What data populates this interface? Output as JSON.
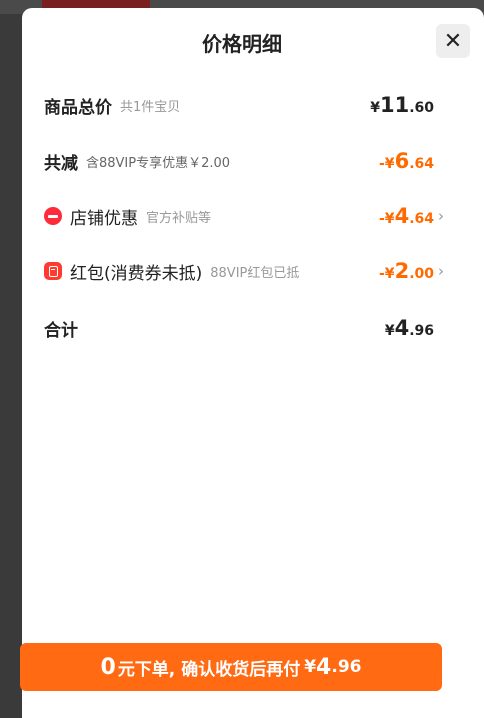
{
  "title": "价格明细",
  "close_symbol": "✕",
  "rows": {
    "total": {
      "label": "商品总价",
      "sub": "共1件宝贝",
      "currency": "¥",
      "amount_int": "11",
      "amount_dec": ".60"
    },
    "reduction": {
      "label": "共减",
      "sub": "含88VIP专享优惠￥2.00",
      "currency": "-¥",
      "amount_int": "6",
      "amount_dec": ".64"
    },
    "shop_discount": {
      "icon": "shop-discount-icon",
      "label": "店铺优惠",
      "sub": "官方补贴等",
      "currency": "-¥",
      "amount_int": "4",
      "amount_dec": ".64",
      "chevron": "›"
    },
    "red_packet": {
      "icon": "red-packet-icon",
      "label": "红包(消费券未抵)",
      "sub": "88VIP红包已抵",
      "currency": "-¥",
      "amount_int": "2",
      "amount_dec": ".00",
      "chevron": "›"
    },
    "sum": {
      "label": "合计",
      "currency": "¥",
      "amount_int": "4",
      "amount_dec": ".96"
    }
  },
  "pay_button": {
    "zero": "0",
    "text": "元下单, 确认收货后再付",
    "currency": "¥",
    "amount_int": "4",
    "amount_dec": ".96"
  },
  "colors": {
    "accent": "#ff6a00",
    "button": "#ff6a12",
    "icon_red": "#ff2a3a"
  }
}
